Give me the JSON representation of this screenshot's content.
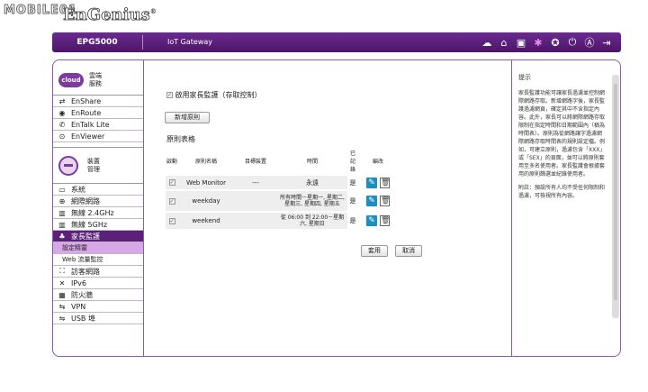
{
  "watermark": "MOBILE01",
  "brand": {
    "logo": "EnGenius",
    "reg": "®"
  },
  "header": {
    "model": "EPG5000",
    "product": "IoT Gateway"
  },
  "top_icons": [
    "cloud-upload-icon",
    "home-icon",
    "save-icon",
    "gear-icon",
    "wand-icon",
    "power-icon",
    "user-icon",
    "logout-icon"
  ],
  "sidebar": {
    "cloud_badge": "cloud",
    "cloud_title": "雲端服務",
    "cloud_items": [
      {
        "label": "EnShare",
        "icon": "enshare-icon"
      },
      {
        "label": "EnRoute",
        "icon": "enroute-icon"
      },
      {
        "label": "EnTalk Lite",
        "icon": "entalk-icon"
      },
      {
        "label": "EnViewer",
        "icon": "enviewer-icon"
      }
    ],
    "device_title": "裝置管理",
    "device_items": [
      {
        "label": "系統",
        "icon": "monitor-icon"
      },
      {
        "label": "網際網路",
        "icon": "globe-icon"
      },
      {
        "label": "無線 2.4GHz",
        "icon": "wifi-icon"
      },
      {
        "label": "無線 5GHz",
        "icon": "wifi-icon"
      },
      {
        "label": "家長監護",
        "icon": "family-icon",
        "active": true
      },
      {
        "label": "設定精靈",
        "sub": true,
        "active": true
      },
      {
        "label": "Web 流量監控",
        "sub": true
      },
      {
        "label": "訪客網路",
        "icon": "network-icon"
      },
      {
        "label": "IPv6",
        "icon": "tools-icon"
      },
      {
        "label": "防火牆",
        "icon": "firewall-icon"
      },
      {
        "label": "VPN",
        "icon": "vpn-icon"
      },
      {
        "label": "USB 埠",
        "icon": "usb-icon"
      }
    ]
  },
  "main": {
    "enable_label": "啟用家長監護（存取控制）",
    "add_button": "新增原則",
    "table_title": "原則表格",
    "columns": [
      "啟動",
      "原則名稱",
      "目標裝置",
      "時間",
      "已記錄",
      "編改"
    ],
    "rows": [
      {
        "name": "Web Monitor",
        "device": "---",
        "time": "永遠",
        "logged": "是"
      },
      {
        "name": "weekday",
        "device": "",
        "time": "所有時間－星期一, 星期二, 星期三, 星期四, 星期五",
        "logged": "是"
      },
      {
        "name": "weekend",
        "device": "",
        "time": "從 06:00 到 22:00－星期六, 星期日",
        "logged": "是"
      }
    ],
    "apply_button": "套用",
    "cancel_button": "取消"
  },
  "help": {
    "title": "提示",
    "body": "家長監護功能可讓家長過濾並控制網際網路存取。新增網路字後，家長監護過濾網頁，確定其中不含指定內容。此外，家長可以將網際網路存取限制在指定時間和日期範圍內（稱為時間表）。原則為從網路讓字過濾網際網路存取時間表的規則設定檔。例如，可建立原則，過濾包含「XXX」或「SEX」的頁面，並可以將原則套用至多名使用者。家長監護會根據套用的原則篩選並紀錄使用者。",
    "note": "附註：預設所有人均不受任何限制和過濾，可檢視所有內容。"
  }
}
